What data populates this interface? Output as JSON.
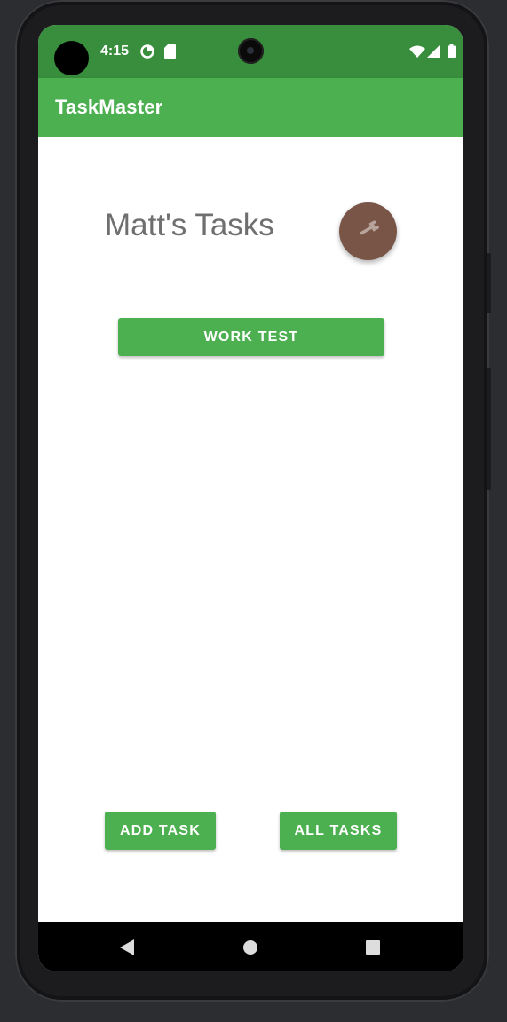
{
  "status_bar": {
    "time": "4:15",
    "icons": [
      "data-saver-icon",
      "sd-card-icon",
      "wifi-icon",
      "cellular-signal-icon",
      "battery-icon"
    ]
  },
  "app_bar": {
    "title": "TaskMaster"
  },
  "main": {
    "heading": "Matt's Tasks",
    "settings_fab_icon": "wrench-icon",
    "tasks": [
      {
        "label": "WORK TEST"
      }
    ],
    "add_task_label": "ADD TASK",
    "all_tasks_label": "ALL TASKS"
  },
  "nav_bar": {
    "icons": [
      "back-icon",
      "home-icon",
      "recents-icon"
    ]
  },
  "colors": {
    "status_bar": "#388e3c",
    "app_bar": "#4caf50",
    "button": "#4caf50",
    "fab": "#795548",
    "heading_text": "#6f6f6f"
  }
}
